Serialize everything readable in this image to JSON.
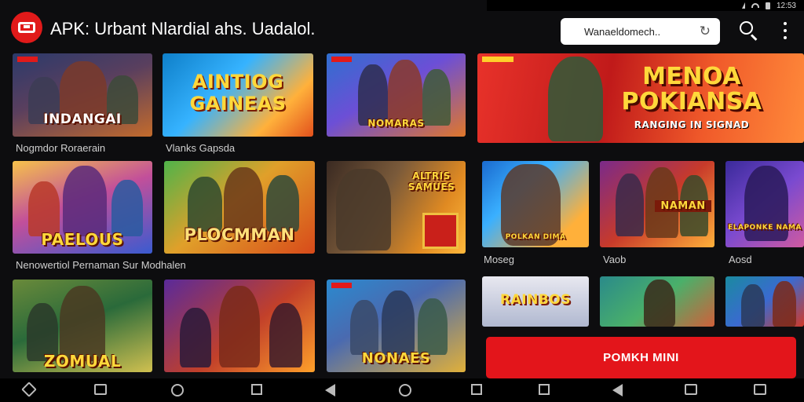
{
  "app": {
    "title": "APK: Urbant Nlardial ahs. Uadalol.",
    "logo_icon": "app-logo-icon",
    "brand_color": "#e11a1a"
  },
  "search": {
    "placeholder": "Wanaeldomech..",
    "value": "Wanaeldomech.."
  },
  "status_bar": {
    "time": "12:53"
  },
  "tiles": [
    {
      "label": "INDANGAI"
    },
    {
      "label": "AINTIOG GAINEAS"
    },
    {
      "label": "NOMARAS"
    },
    {
      "label": "MENOA POKIANSA",
      "sublabel": "RANGING IN SIGNAD"
    },
    {
      "label": "PAELOUS"
    },
    {
      "label": "PLOCMMAN"
    },
    {
      "label": "ALTRIS SAMUES"
    },
    {
      "label": "POLKAN DIMA"
    },
    {
      "label": "NAMAN"
    },
    {
      "label": "ELAPONKE NAMA"
    },
    {
      "label": "ZOMUAL"
    },
    {
      "label": "NONAES"
    },
    {
      "label": "RAINBOS"
    }
  ],
  "captions": {
    "row1_left": "Nogmdor Roraerain",
    "row1_mid": "Vlanks Gapsda",
    "row2_left": "Nenowertiol Pernaman Sur Modhalen",
    "row2_r1": "Moseg",
    "row2_r2": "Vaob",
    "row2_r3": "Aosd"
  },
  "cta": {
    "label": "POMKH MINI",
    "color": "#e3151b"
  },
  "navbar": {
    "icons": [
      "back-icon",
      "tabs-icon",
      "home-icon",
      "recent-apps-icon",
      "back-icon",
      "home-icon",
      "recent-apps-icon",
      "recent-apps-icon",
      "back-icon",
      "tabs-icon",
      "tabs-icon"
    ]
  }
}
